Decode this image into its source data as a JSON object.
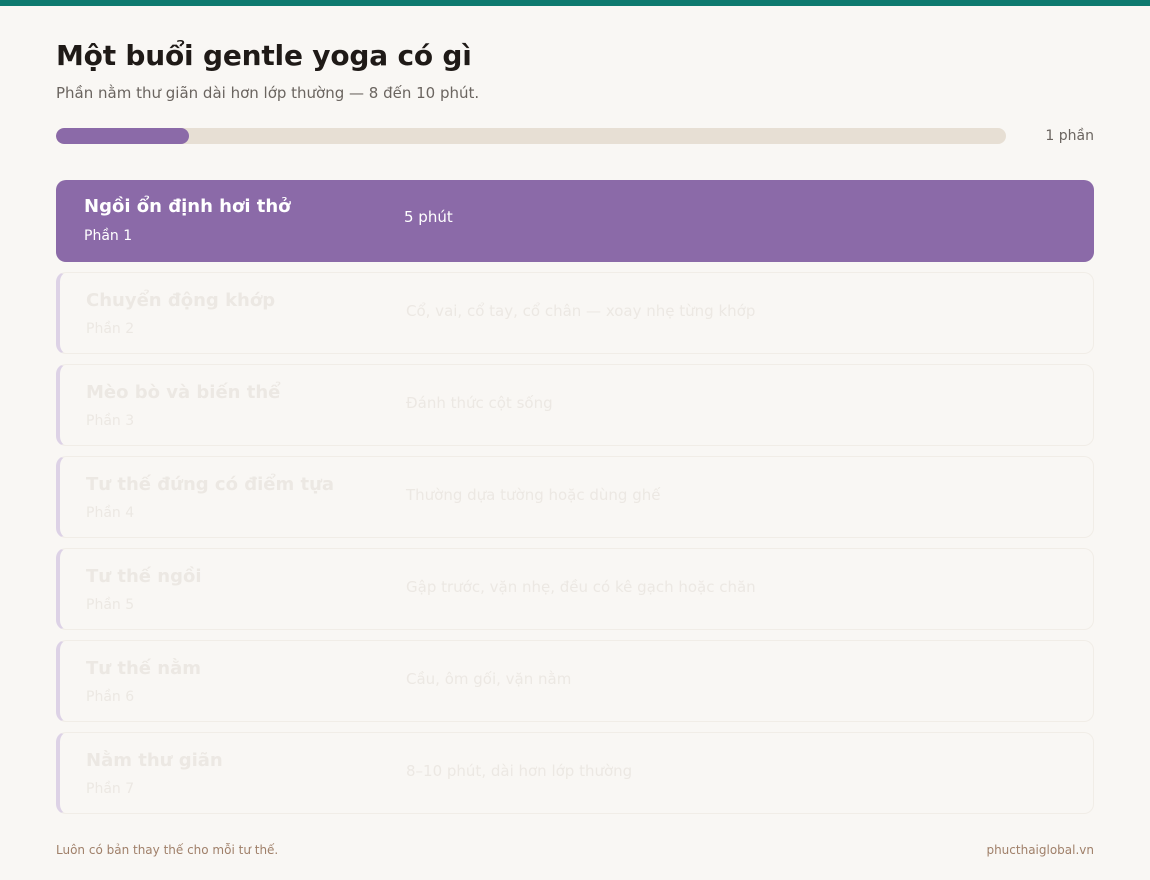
{
  "header": {
    "title": "Một buổi gentle yoga có gì",
    "subtitle": "Phần nằm thư giãn dài hơn lớp thường — 8 đến 10 phút."
  },
  "progress": {
    "value": 0.14,
    "label": "1 phần"
  },
  "parts": [
    {
      "title": "Ngồi ổn định hơi thở",
      "part": "Phần 1",
      "desc": "5 phút",
      "active": true
    },
    {
      "title": "Chuyển động khớp",
      "part": "Phần 2",
      "desc": "Cổ, vai, cổ tay, cổ chân — xoay nhẹ từng khớp",
      "active": false
    },
    {
      "title": "Mèo bò và biến thể",
      "part": "Phần 3",
      "desc": "Đánh thức cột sống",
      "active": false
    },
    {
      "title": "Tư thế đứng có điểm tựa",
      "part": "Phần 4",
      "desc": "Thường dựa tường hoặc dùng ghế",
      "active": false
    },
    {
      "title": "Tư thế ngồi",
      "part": "Phần 5",
      "desc": "Gập trước, vặn nhẹ, đều có kê gạch hoặc chăn",
      "active": false
    },
    {
      "title": "Tư thế nằm",
      "part": "Phần 6",
      "desc": "Cầu, ôm gối, vặn nằm",
      "active": false
    },
    {
      "title": "Nằm thư giãn",
      "part": "Phần 7",
      "desc": "8–10 phút, dài hơn lớp thường",
      "active": false
    }
  ],
  "footer": {
    "note": "Luôn có bản thay thế cho mỗi tư thế.",
    "site": "phucthaiglobal.vn"
  },
  "colors": {
    "accent_top": "#0f7a6f",
    "active": "#8b6aa8",
    "track": "#e7dfd4"
  }
}
